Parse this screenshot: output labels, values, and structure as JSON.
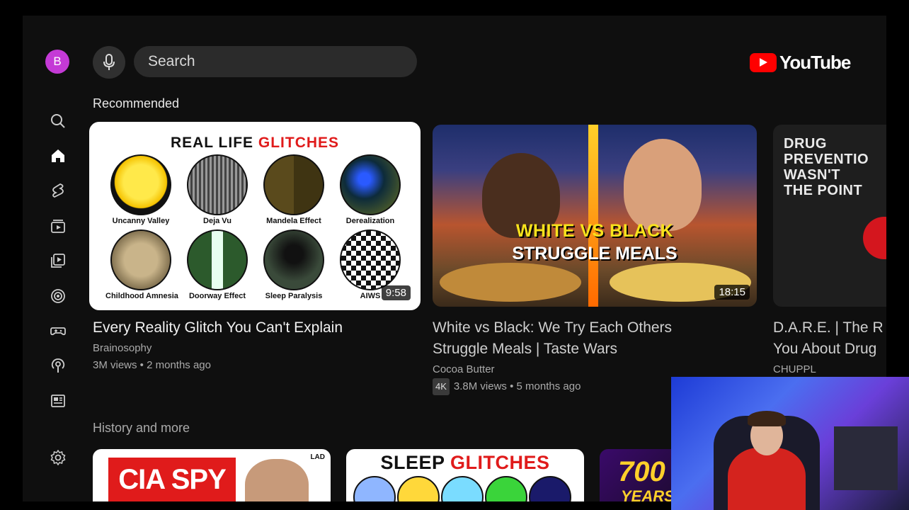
{
  "header": {
    "avatar_letter": "B",
    "search_placeholder": "Search",
    "logo_text": "YouTube"
  },
  "sidebar": {
    "items": [
      {
        "icon": "search-icon"
      },
      {
        "icon": "home-icon"
      },
      {
        "icon": "shorts-icon"
      },
      {
        "icon": "subscriptions-icon"
      },
      {
        "icon": "library-icon"
      },
      {
        "icon": "live-icon"
      },
      {
        "icon": "gaming-icon"
      },
      {
        "icon": "podcasts-icon"
      },
      {
        "icon": "news-icon"
      },
      {
        "icon": "settings-icon"
      }
    ]
  },
  "recommended": {
    "heading": "Recommended",
    "videos": [
      {
        "title": "Every Reality Glitch You Can't Explain",
        "channel": "Brainosophy",
        "meta": "3M views • 2 months ago",
        "duration": "9:58",
        "thumb_title_a": "REAL LIFE ",
        "thumb_title_b": "GLITCHES",
        "thumb_labels": [
          "Uncanny Valley",
          "Deja Vu",
          "Mandela Effect",
          "Derealization",
          "Childhood Amnesia",
          "Doorway Effect",
          "Sleep Paralysis",
          "AIWS"
        ]
      },
      {
        "title_line1": "White vs Black: We Try Each Others",
        "title_line2": "Struggle Meals |  Taste Wars",
        "channel": "Cocoa Butter",
        "badge": "4K",
        "meta": "3.8M views • 5 months ago",
        "duration": "18:15",
        "thumb_line1": "WHITE VS BLACK",
        "thumb_line2": "STRUGGLE MEALS"
      },
      {
        "title_line1": "D.A.R.E. | The R",
        "title_line2": "You About Drug",
        "channel": "CHUPPL",
        "thumb_text": "DRUG\nPREVENTIO\nWASN'T\nTHE POINT"
      }
    ]
  },
  "history": {
    "heading": "History and more",
    "thumbs": [
      {
        "text": "CIA SPY",
        "corner": "LAD"
      },
      {
        "text_a": "SLEEP ",
        "text_b": "GLITCHES"
      },
      {
        "text": "700",
        "sub": "YEARS"
      }
    ]
  },
  "colors": {
    "background": "#0f0f0f",
    "accent_red": "#ff0000",
    "avatar": "#c43ad6",
    "meta_text": "#aaaaaa"
  }
}
